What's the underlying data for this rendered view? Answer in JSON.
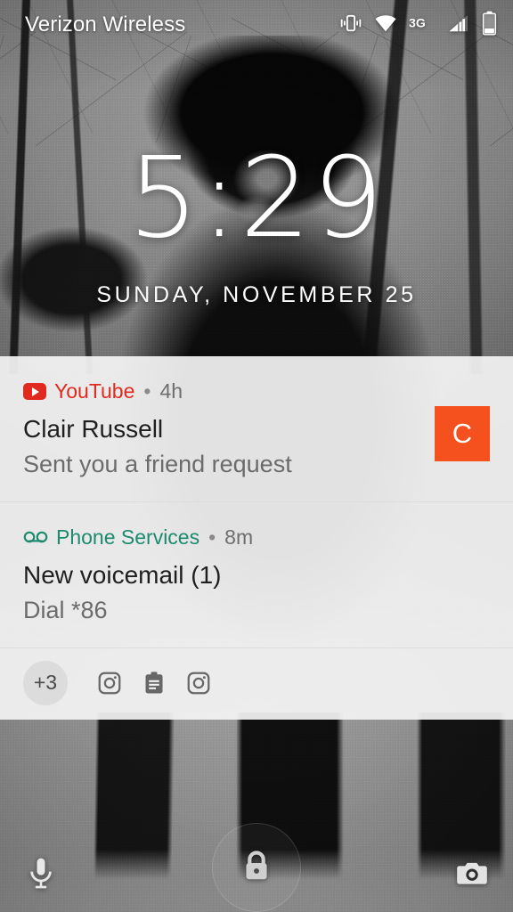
{
  "status_bar": {
    "carrier": "Verizon Wireless",
    "icons": [
      {
        "name": "vibrate-icon",
        "label": "Vibrate"
      },
      {
        "name": "wifi-icon",
        "label": "Wi-Fi"
      },
      {
        "name": "network-type-icon",
        "label": "3G"
      },
      {
        "name": "signal-bars-icon",
        "label": "Cellular signal"
      },
      {
        "name": "battery-icon",
        "label": "Battery"
      }
    ],
    "network_type": "3G",
    "text_color": "#ffffff"
  },
  "lock_screen": {
    "time": "5:29",
    "date": "SUNDAY, NOVEMBER 25"
  },
  "notifications": [
    {
      "app": "YouTube",
      "app_color": "#e02a1f",
      "icon": "youtube-icon",
      "time": "4h",
      "separator": "•",
      "title": "Clair Russell",
      "body": "Sent you a friend request",
      "avatar_letter": "C",
      "avatar_color": "#f4511e",
      "has_avatar": true
    },
    {
      "app": "Phone Services",
      "app_color": "#1d8a6e",
      "icon": "voicemail-icon",
      "time": "8m",
      "separator": "•",
      "title": "New voicemail (1)",
      "body": "Dial *86",
      "has_avatar": false
    }
  ],
  "overflow": {
    "more_count": "+3",
    "icons": [
      {
        "name": "instagram-icon",
        "label": "Instagram"
      },
      {
        "name": "clipboard-icon",
        "label": "Notes"
      },
      {
        "name": "instagram-icon",
        "label": "Instagram"
      }
    ]
  },
  "bottom_bar": {
    "left_shortcut": {
      "name": "microphone-icon",
      "label": "Voice assistant"
    },
    "center": {
      "name": "lock-icon",
      "label": "Locked"
    },
    "right_shortcut": {
      "name": "camera-icon",
      "label": "Camera"
    }
  },
  "theme": {
    "shade_background": "#f3f3f3",
    "divider": "#dcdcdc",
    "title_text": "#1f1f1f",
    "body_text": "#6b6b6b"
  }
}
